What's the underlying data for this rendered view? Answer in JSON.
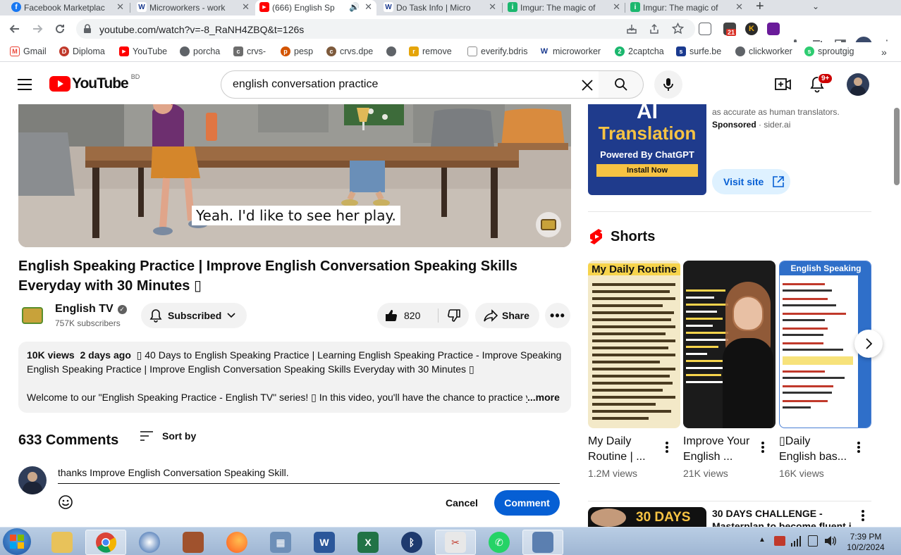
{
  "browser": {
    "tabs": [
      {
        "title": "Facebook Marketplac",
        "favicon_color": "#1877f2",
        "favicon_glyph": "f",
        "active": false
      },
      {
        "title": "Microworkers - work",
        "favicon_color": "#1a3a8f",
        "favicon_glyph": "W",
        "active": false
      },
      {
        "title": "(666) English Sp",
        "favicon_color": "#ff0000",
        "favicon_glyph": "▶",
        "active": true
      },
      {
        "title": "Do Task Info | Micro",
        "favicon_color": "#1a3a8f",
        "favicon_glyph": "W",
        "active": false
      },
      {
        "title": "Imgur: The magic of",
        "favicon_color": "#1bb76e",
        "favicon_glyph": "i",
        "active": false
      },
      {
        "title": "Imgur: The magic of",
        "favicon_color": "#1bb76e",
        "favicon_glyph": "i",
        "active": false
      }
    ],
    "new_tab": "+",
    "url": "youtube.com/watch?v=-8_RaNH4ZBQ&t=126s",
    "ext_badge": "21",
    "bookmarks": [
      {
        "label": "Gmail",
        "color": "#ea4335",
        "glyph": "M"
      },
      {
        "label": "Diploma",
        "color": "#c0392b",
        "glyph": "D"
      },
      {
        "label": "YouTube",
        "color": "#ff0000",
        "glyph": "▶"
      },
      {
        "label": "porcha",
        "color": "#5f6368",
        "glyph": "●"
      },
      {
        "label": "crvs-",
        "color": "#6d6d6d",
        "glyph": "c"
      },
      {
        "label": "pesp",
        "color": "#d35400",
        "glyph": "p"
      },
      {
        "label": "crvs.dpe",
        "color": "#7d5a3c",
        "glyph": "c"
      },
      {
        "label": "",
        "color": "#5f6368",
        "glyph": "●"
      },
      {
        "label": "remove",
        "color": "#e5a50a",
        "glyph": "r"
      },
      {
        "label": "everify.bdris",
        "color": "#8e8e8e",
        "glyph": "e"
      },
      {
        "label": "microworker",
        "color": "#1a3a8f",
        "glyph": "W"
      },
      {
        "label": "2captcha",
        "color": "#1bb76e",
        "glyph": "2"
      },
      {
        "label": "surfe.be",
        "color": "#1a3a8f",
        "glyph": "s"
      },
      {
        "label": "clickworker",
        "color": "#5f6368",
        "glyph": "●"
      },
      {
        "label": "sproutgig",
        "color": "#2ecc71",
        "glyph": "s"
      }
    ],
    "more_bookmarks": "»"
  },
  "youtube": {
    "logo_text": "YouTube",
    "country_code": "BD",
    "search_value": "english conversation practice",
    "notification_count": "9+",
    "subtitle": "Yeah. I'd like to see her play.",
    "video_title": "English Speaking Practice | Improve English Conversation Speaking Skills Everyday with 30 Minutes ▯",
    "channel_name": "English TV",
    "subscribers": "757K subscribers",
    "subscribe_label": "Subscribed",
    "likes": "820",
    "share_label": "Share",
    "description": {
      "views": "10K views",
      "age": "2 days ago",
      "playlist": "▯ 40 Days to English Speaking Practice | Learning English Speaking Practice - Improve Speaking S",
      "line2": "English Speaking Practice | Improve English Conversation Speaking Skills Everyday with 30 Minutes ▯",
      "line3": "Welcome to our \"English Speaking Practice - English TV\" series! ▯ In this video, you'll have the chance to practice y",
      "more": "...more"
    },
    "comments": {
      "count_label": "633 Comments",
      "sort_label": "Sort by",
      "draft": "thanks Improve English Conversation Speaking Skill.",
      "cancel_label": "Cancel",
      "comment_label": "Comment"
    },
    "ad": {
      "headline_top": "AI",
      "headline": "Translation",
      "powered": "Powered By ChatGPT",
      "install": "Install Now",
      "desc": "as accurate as human translators.",
      "sponsored": "Sponsored",
      "domain": "sider.ai",
      "visit_label": "Visit site"
    },
    "shorts_header": "Shorts",
    "shorts": [
      {
        "title_line1": "My Daily",
        "title_line2": "Routine | ...",
        "views": "1.2M views",
        "thumb_heading": "My Daily Routine"
      },
      {
        "title_line1": "Improve Your",
        "title_line2": "English ...",
        "views": "21K views",
        "thumb_heading": ""
      },
      {
        "title_line1": "▯Daily",
        "title_line2": "English bas...",
        "views": "16K views",
        "thumb_heading": "English Speaking"
      }
    ],
    "next_video": {
      "thumb_text": "30 DAYS",
      "title_line1": "30 DAYS CHALLENGE -",
      "title_line2": "Masterplan to become fluent i"
    }
  },
  "taskbar": {
    "time": "7:39 PM",
    "date": "10/2/2024"
  }
}
